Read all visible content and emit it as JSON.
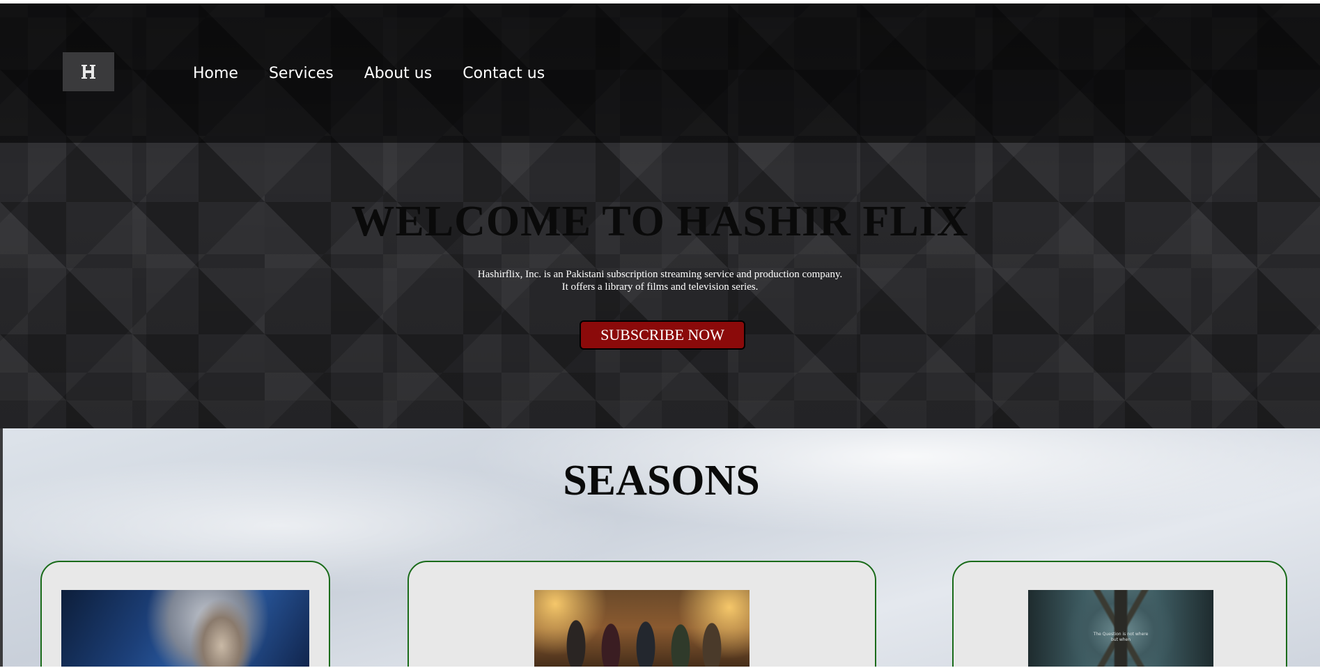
{
  "nav": {
    "logo_alt": "H",
    "links": [
      "Home",
      "Services",
      "About us",
      "Contact us"
    ]
  },
  "hero": {
    "title": "WELCOME TO HASHIR FLIX",
    "description_line1": "Hashirflix, Inc. is an Pakistani subscription streaming service and production company.",
    "description_line2": "It offers a library of films and television series.",
    "cta_label": "SUBSCRIBE NOW",
    "cta_color": "#8b0a0a"
  },
  "seasons": {
    "title": "SEASONS",
    "card_border_color": "#1a6b1a",
    "cards": [
      {
        "image_icon": "witcher-poster"
      },
      {
        "image_icon": "harry-potter-reunion-poster"
      },
      {
        "image_icon": "dark-series-poster",
        "poster_text_line1": "The Question is not where",
        "poster_text_line2": "but when"
      }
    ]
  }
}
